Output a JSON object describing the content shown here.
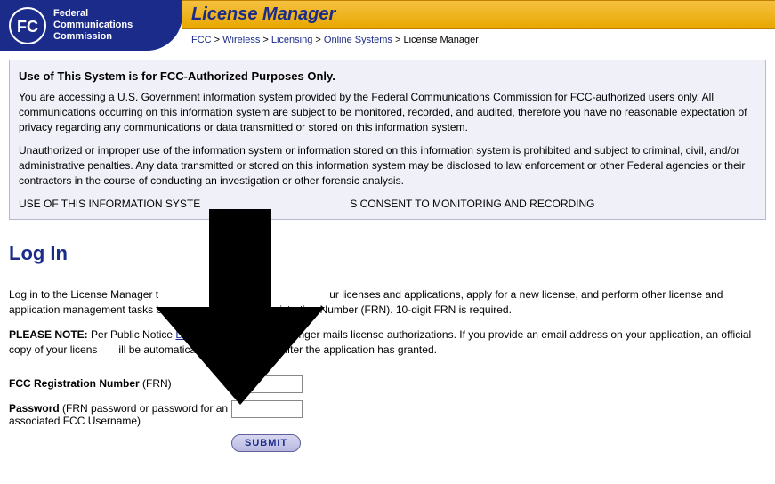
{
  "header": {
    "org_line1": "Federal",
    "org_line2": "Communications",
    "org_line3": "Commission",
    "title": "License Manager"
  },
  "breadcrumb": {
    "items": [
      "FCC",
      "Wireless",
      "Licensing",
      "Online Systems"
    ],
    "current": "License Manager",
    "separator": " > "
  },
  "notice": {
    "heading": "Use of This System is for FCC-Authorized Purposes Only.",
    "p1": "You are accessing a U.S. Government information system provided by the Federal Communications Commission for FCC-authorized users only. All communications occurring on this information system are subject to be monitored, recorded, and audited, therefore you have no reasonable expectation of privacy regarding any communications or data transmitted or stored on this information system.",
    "p2": "Unauthorized or improper use of the information system or information stored on this information system is prohibited and subject to criminal, civil, and/or administrative penalties. Any data transmitted or stored on this information system may be disclosed to law enforcement or other Federal agencies or their contractors in the course of conducting an investigation or other forensic analysis.",
    "consent_prefix": "USE OF THIS INFORMATION SYSTE",
    "consent_suffix": "S CONSENT TO MONITORING AND RECORDING"
  },
  "login": {
    "heading": "Log In",
    "intro_prefix": "Log in to the License Manager t",
    "intro_mid": "ur licenses and applications, apply for a new license, and perform other license and application management tasks ba",
    "intro_suffix": "egistration Number (FRN). 10-digit FRN is required.",
    "note_label": "PLEASE NOTE:",
    "note_prefix": " Per Public Notice ",
    "note_link": "DA 1",
    "note_mid": "e FCC no longer mails license authorizations. If you provide an email address on your application, an official copy of your licens",
    "note_suffix": "ill be automatically emailed to you after the application has granted.",
    "frn_label_bold": "FCC Registration Number",
    "frn_label_rest": " (FRN)",
    "pwd_label_bold": "Password",
    "pwd_label_rest": " (FRN password or password for an associated FCC Username)",
    "submit": "SUBMIT"
  }
}
